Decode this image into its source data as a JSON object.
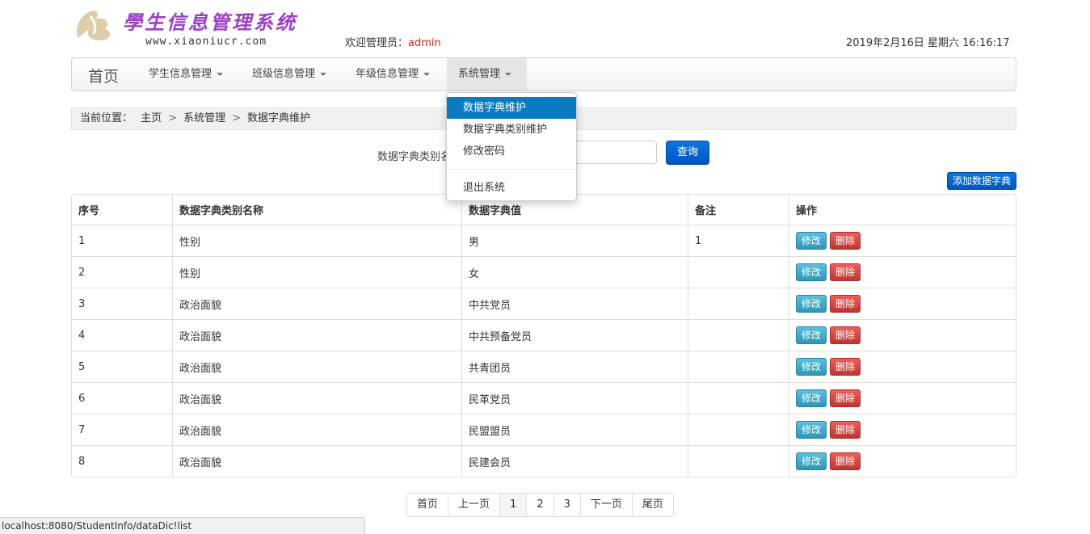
{
  "header": {
    "site_title": "學生信息管理系统",
    "site_url": "www.xiaoniucr.com",
    "welcome_prefix": "欢迎管理员：",
    "admin_name": "admin",
    "datetime": "2019年2月16日 星期六 16:16:17"
  },
  "navbar": {
    "brand": "首页",
    "items": [
      {
        "label": "学生信息管理"
      },
      {
        "label": "班级信息管理"
      },
      {
        "label": "年级信息管理"
      },
      {
        "label": "系统管理"
      }
    ]
  },
  "dropdown": {
    "items": [
      "数据字典维护",
      "数据字典类别维护",
      "修改密码"
    ],
    "logout": "退出系统"
  },
  "breadcrumb": {
    "prefix": "当前位置：",
    "home": "主页",
    "sep": ">",
    "section": "系统管理",
    "page": "数据字典维护"
  },
  "search": {
    "label": "数据字典类别名",
    "value": "",
    "query_label": "查询"
  },
  "add_button": "添加数据字典",
  "table": {
    "headers": [
      "序号",
      "数据字典类别名称",
      "数据字典值",
      "备注",
      "操作"
    ],
    "edit_label": "修改",
    "delete_label": "删除",
    "rows": [
      {
        "id": "1",
        "category": "性别",
        "value": "男",
        "remark": "1"
      },
      {
        "id": "2",
        "category": "性别",
        "value": "女",
        "remark": ""
      },
      {
        "id": "3",
        "category": "政治面貌",
        "value": "中共党员",
        "remark": ""
      },
      {
        "id": "4",
        "category": "政治面貌",
        "value": "中共预备党员",
        "remark": ""
      },
      {
        "id": "5",
        "category": "政治面貌",
        "value": "共青团员",
        "remark": ""
      },
      {
        "id": "6",
        "category": "政治面貌",
        "value": "民革党员",
        "remark": ""
      },
      {
        "id": "7",
        "category": "政治面貌",
        "value": "民盟盟员",
        "remark": ""
      },
      {
        "id": "8",
        "category": "政治面貌",
        "value": "民建会员",
        "remark": ""
      }
    ]
  },
  "pagination": {
    "first": "首页",
    "prev": "上一页",
    "pages": [
      "1",
      "2",
      "3"
    ],
    "current": "1",
    "next": "下一页",
    "last": "尾页"
  },
  "statusbar": {
    "url": "localhost:8080/StudentInfo/dataDic!list"
  },
  "colors": {
    "accent": "#0a7bc1",
    "title": "#9b3fc5",
    "admin": "#d9261c",
    "danger": "#bd362f",
    "info": "#2f96b4"
  }
}
